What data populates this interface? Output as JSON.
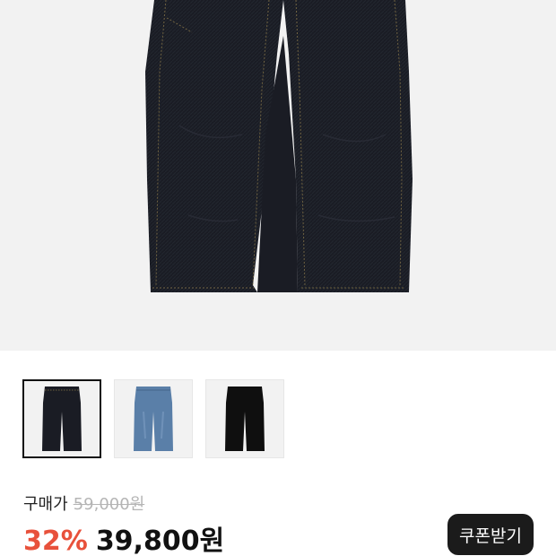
{
  "product": {
    "image_alt": "dark indigo wide denim jeans",
    "thumbnails": [
      {
        "color": "dark-indigo",
        "fill": "#1a1c24",
        "stitch": "#8c7a4a",
        "selected": true
      },
      {
        "color": "mid-blue",
        "fill": "#5a7fa8",
        "stitch": "#3e5c80",
        "selected": false
      },
      {
        "color": "black",
        "fill": "#0f0f0f",
        "stitch": "#2a2a2a",
        "selected": false
      }
    ]
  },
  "price": {
    "label": "구매가",
    "original": "59,000원",
    "discount": "32%",
    "sale": "39,800원"
  },
  "coupon": {
    "label": "쿠폰받기"
  },
  "colors": {
    "discount_red": "#e8513b",
    "button_dark": "#1b1b1b",
    "image_bg": "#f2f2f2"
  }
}
